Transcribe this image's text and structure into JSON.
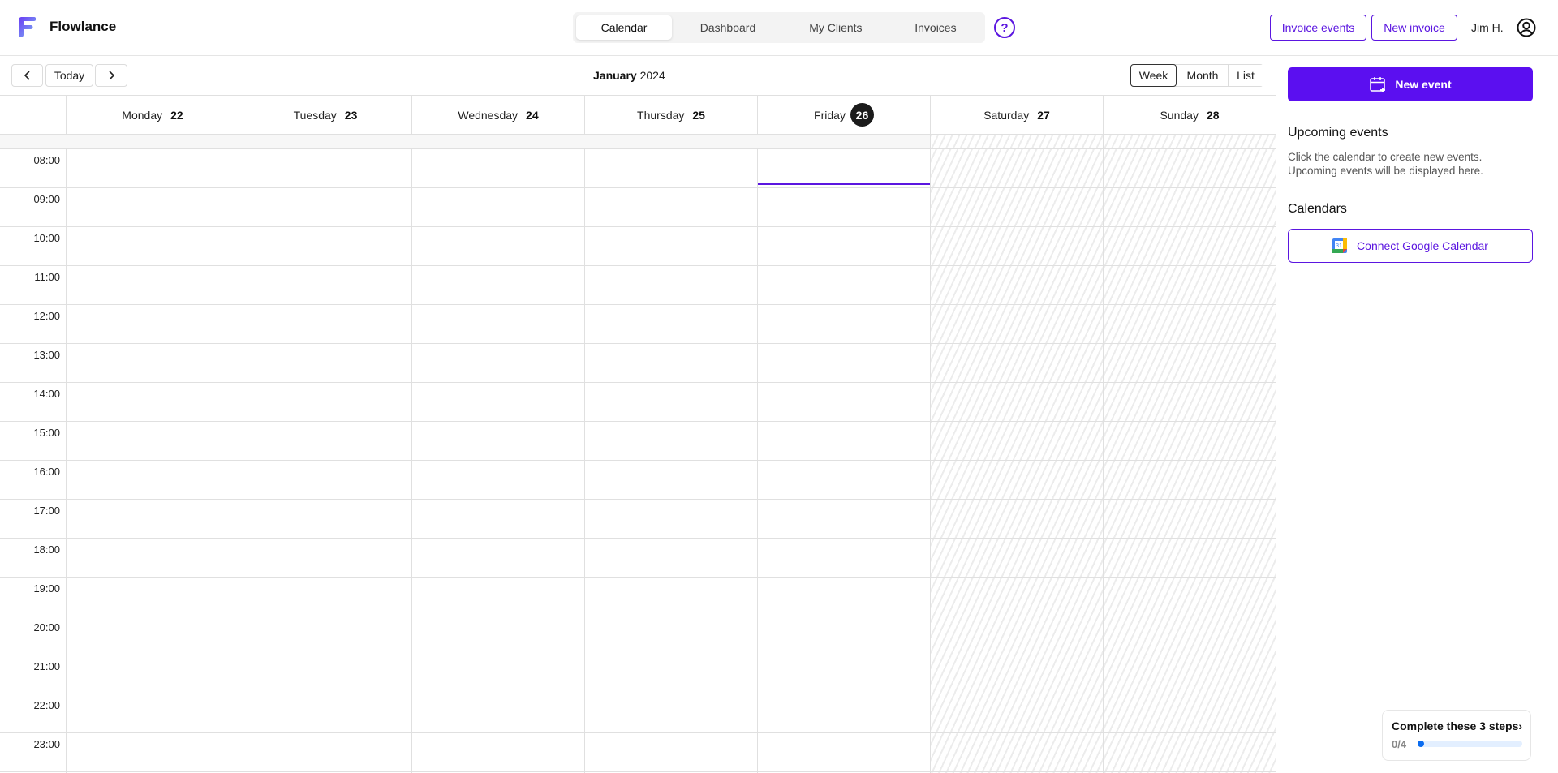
{
  "header": {
    "brand": "Flowlance",
    "logo_icon": "flowlance-logo-icon",
    "nav": [
      {
        "label": "Calendar",
        "active": true
      },
      {
        "label": "Dashboard",
        "active": false
      },
      {
        "label": "My Clients",
        "active": false
      },
      {
        "label": "Invoices",
        "active": false
      }
    ],
    "help_label": "?",
    "invoice_events_label": "Invoice events",
    "new_invoice_label": "New invoice",
    "user_name": "Jim H.",
    "accent_color": "#5b16e0"
  },
  "toolbar": {
    "prev_label": "‹",
    "today_label": "Today",
    "next_label": "›",
    "month": "January",
    "year": "2024",
    "views": [
      {
        "label": "Week",
        "active": true
      },
      {
        "label": "Month",
        "active": false
      },
      {
        "label": "List",
        "active": false
      }
    ]
  },
  "calendar": {
    "days": [
      {
        "name": "Monday",
        "date": "22",
        "today": false,
        "weekend": false
      },
      {
        "name": "Tuesday",
        "date": "23",
        "today": false,
        "weekend": false
      },
      {
        "name": "Wednesday",
        "date": "24",
        "today": false,
        "weekend": false
      },
      {
        "name": "Thursday",
        "date": "25",
        "today": false,
        "weekend": false
      },
      {
        "name": "Friday",
        "date": "26",
        "today": true,
        "weekend": false
      },
      {
        "name": "Saturday",
        "date": "27",
        "today": false,
        "weekend": true
      },
      {
        "name": "Sunday",
        "date": "28",
        "today": false,
        "weekend": true
      }
    ],
    "hours": [
      "08:00",
      "09:00",
      "10:00",
      "11:00",
      "12:00",
      "13:00",
      "14:00",
      "15:00",
      "16:00",
      "17:00",
      "18:00",
      "19:00",
      "20:00",
      "21:00",
      "22:00",
      "23:00"
    ],
    "current_time_day": "Friday"
  },
  "panel": {
    "new_event_label": "New event",
    "upcoming_title": "Upcoming events",
    "upcoming_text_1": "Click the calendar to create new events.",
    "upcoming_text_2": "Upcoming events will be displayed here.",
    "calendars_title": "Calendars",
    "connect_google_label": "Connect Google Calendar",
    "google_icon_text": "31"
  },
  "onboarding": {
    "title": "Complete these 3 steps",
    "chevron": "›",
    "progress_text": "0/4",
    "progress_fraction": 0.0,
    "progress_color": "#0a6cf0"
  }
}
